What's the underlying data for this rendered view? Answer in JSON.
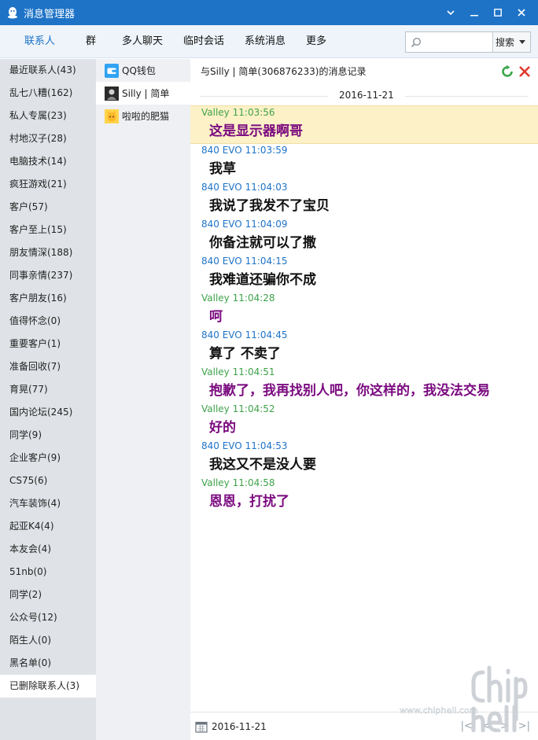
{
  "window": {
    "title": "消息管理器"
  },
  "nav": {
    "tabs": [
      {
        "label": "联系人",
        "active": true
      },
      {
        "label": "群"
      },
      {
        "label": "多人聊天"
      },
      {
        "label": "临时会话"
      },
      {
        "label": "系统消息"
      },
      {
        "label": "更多"
      }
    ],
    "search_value": "",
    "search_button": "搜索"
  },
  "groups": [
    "最近联系人(43)",
    "乱七八糟(162)",
    "私人专属(23)",
    "村地汉子(28)",
    "电脑技术(14)",
    "疯狂游戏(21)",
    "客户(57)",
    "客户至上(15)",
    "朋友情深(188)",
    "同事亲情(237)",
    "客户朋友(16)",
    "值得怀念(0)",
    "重要客户(1)",
    "准备回收(7)",
    "育晃(77)",
    "国内论坛(245)",
    "同学(9)",
    "企业客户(9)",
    "CS75(6)",
    "汽车装饰(4)",
    "起亚K4(4)",
    "本友会(4)",
    "51nb(0)",
    "同学(2)",
    "公众号(12)",
    "陌生人(0)",
    "黑名单(0)",
    "已删除联系人(3)"
  ],
  "contacts": [
    {
      "name": "QQ钱包",
      "avatar": "qq-wallet-icon"
    },
    {
      "name": "Silly | 简单",
      "avatar": "user-avatar",
      "selected": true
    },
    {
      "name": "啦啦的肥猫",
      "avatar": "cat-avatar"
    }
  ],
  "chat": {
    "header": "与Silly | 简单(306876233)的消息记录",
    "date": "2016-11-21",
    "footer_date": "2016-11-21",
    "messages": [
      {
        "sender": "Valley",
        "time": "11:03:56",
        "text": "这是显示器啊哥",
        "me": true,
        "highlight": true
      },
      {
        "sender": "840 EVO",
        "time": "11:03:59",
        "text": "我草"
      },
      {
        "sender": "840 EVO",
        "time": "11:04:03",
        "text": "我说了我发不了宝贝"
      },
      {
        "sender": "840 EVO",
        "time": "11:04:09",
        "text": "你备注就可以了撒"
      },
      {
        "sender": "840 EVO",
        "time": "11:04:15",
        "text": "我难道还骗你不成"
      },
      {
        "sender": "Valley",
        "time": "11:04:28",
        "text": "呵",
        "me": true
      },
      {
        "sender": "840 EVO",
        "time": "11:04:45",
        "text": "算了  不卖了"
      },
      {
        "sender": "Valley",
        "time": "11:04:51",
        "text": "抱歉了，我再找别人吧，你这样的，我没法交易",
        "me": true
      },
      {
        "sender": "Valley",
        "time": "11:04:52",
        "text": "好的",
        "me": true
      },
      {
        "sender": "840 EVO",
        "time": "11:04:53",
        "text": "我这又不是没人要"
      },
      {
        "sender": "Valley",
        "time": "11:04:58",
        "text": "恩恩，打扰了",
        "me": true
      }
    ]
  },
  "watermark": "www.chiphell.com",
  "colors": {
    "titlebar": "#1e73c7",
    "me_meta": "#3ea34a",
    "me_text": "#7a0a7f",
    "other_meta": "#1e73c7",
    "highlight": "#fdf1c7"
  }
}
